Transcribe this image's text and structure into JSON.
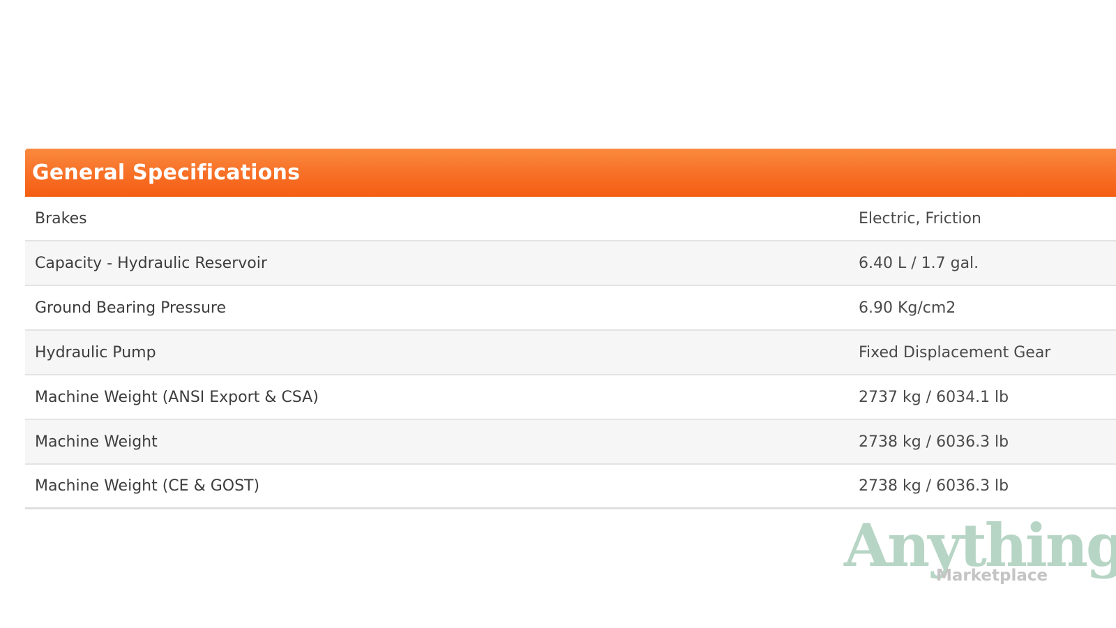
{
  "specs": {
    "title": "General Specifications",
    "rows": [
      {
        "label": "Brakes",
        "value": "Electric, Friction"
      },
      {
        "label": "Capacity - Hydraulic Reservoir",
        "value": "6.40 L / 1.7 gal."
      },
      {
        "label": "Ground Bearing Pressure",
        "value": "6.90 Kg/cm2"
      },
      {
        "label": "Hydraulic Pump",
        "value": "Fixed Displacement Gear"
      },
      {
        "label": "Machine Weight (ANSI Export & CSA)",
        "value": "2737 kg / 6034.1 lb"
      },
      {
        "label": "Machine Weight",
        "value": "2738 kg / 6036.3 lb"
      },
      {
        "label": "Machine Weight (CE & GOST)",
        "value": "2738 kg / 6036.3 lb"
      }
    ]
  },
  "watermark": {
    "main": "Anything",
    "sub": "Marketplace"
  },
  "colors": {
    "header_accent": "#f8732a",
    "watermark_green": "#b7d5c5"
  }
}
